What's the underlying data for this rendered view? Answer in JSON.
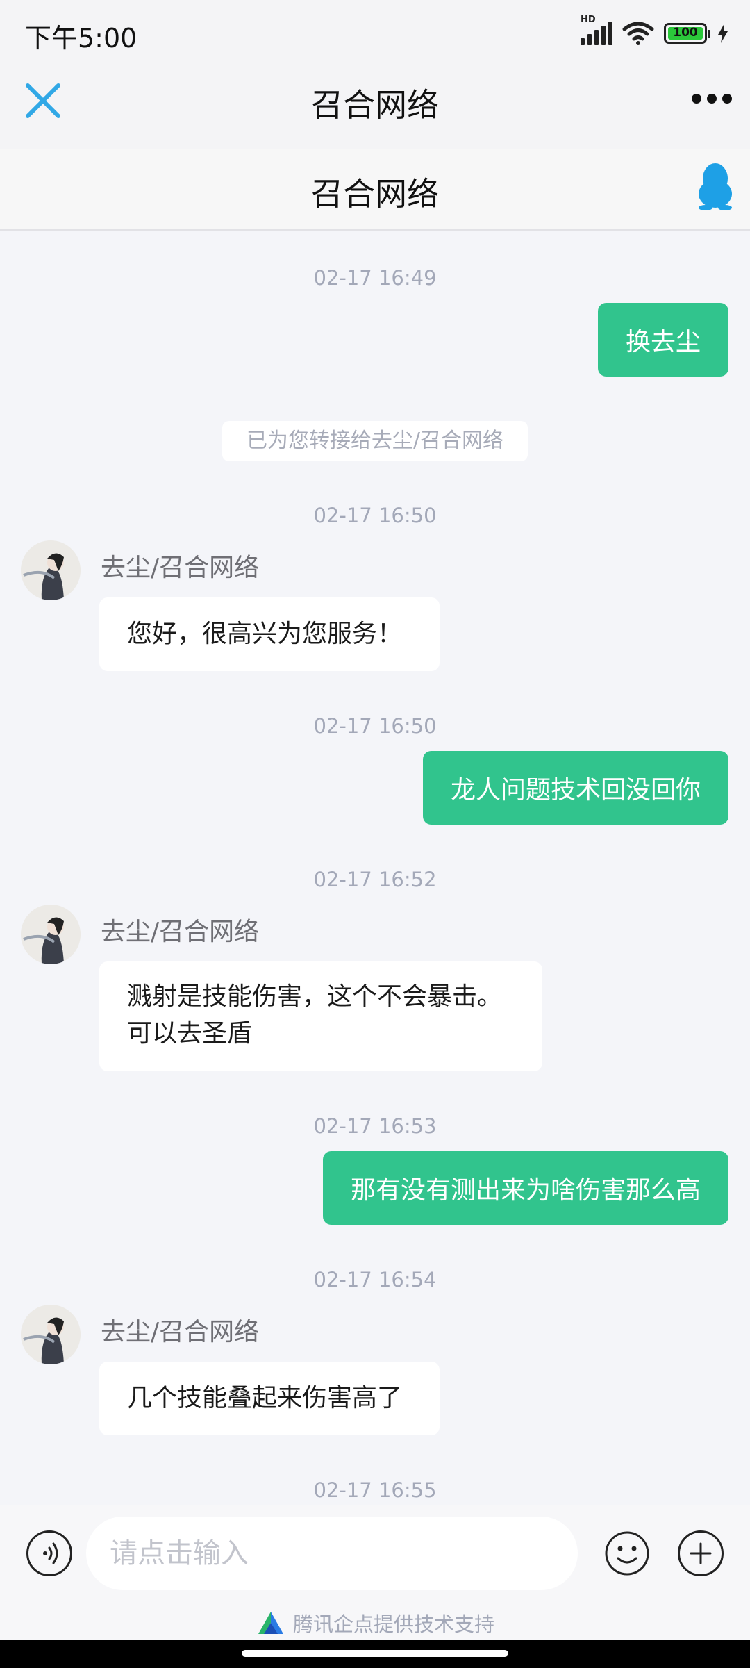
{
  "status": {
    "time": "下午5:00",
    "battery": "100",
    "net_label": "HD"
  },
  "nav": {
    "title": "召合网络"
  },
  "sub": {
    "title": "召合网络"
  },
  "chat": {
    "ts1": "02-17 16:49",
    "msg1": "换去尘",
    "notice": "已为您转接给去尘/召合网络",
    "ts2": "02-17 16:50",
    "agent1": "去尘/召合网络",
    "msg2": "您好，很高兴为您服务！",
    "ts3": "02-17 16:50",
    "msg3": "龙人问题技术回没回你",
    "ts4": "02-17 16:52",
    "agent2": "去尘/召合网络",
    "msg4_line1": "溅射是技能伤害，这个不会暴击。",
    "msg4_line2": "可以去圣盾",
    "ts5": "02-17 16:53",
    "msg5": "那有没有测出来为啥伤害那么高",
    "ts6": "02-17 16:54",
    "agent3": "去尘/召合网络",
    "msg6": "几个技能叠起来伤害高了",
    "ts7": "02-17 16:55"
  },
  "input": {
    "placeholder": "请点击输入"
  },
  "footer": {
    "text": "腾讯企点提供技术支持"
  },
  "colors": {
    "accent": "#31c48d",
    "timestamp": "#a3a8b8",
    "close": "#31a8e6",
    "qq": "#1ea0e6"
  }
}
